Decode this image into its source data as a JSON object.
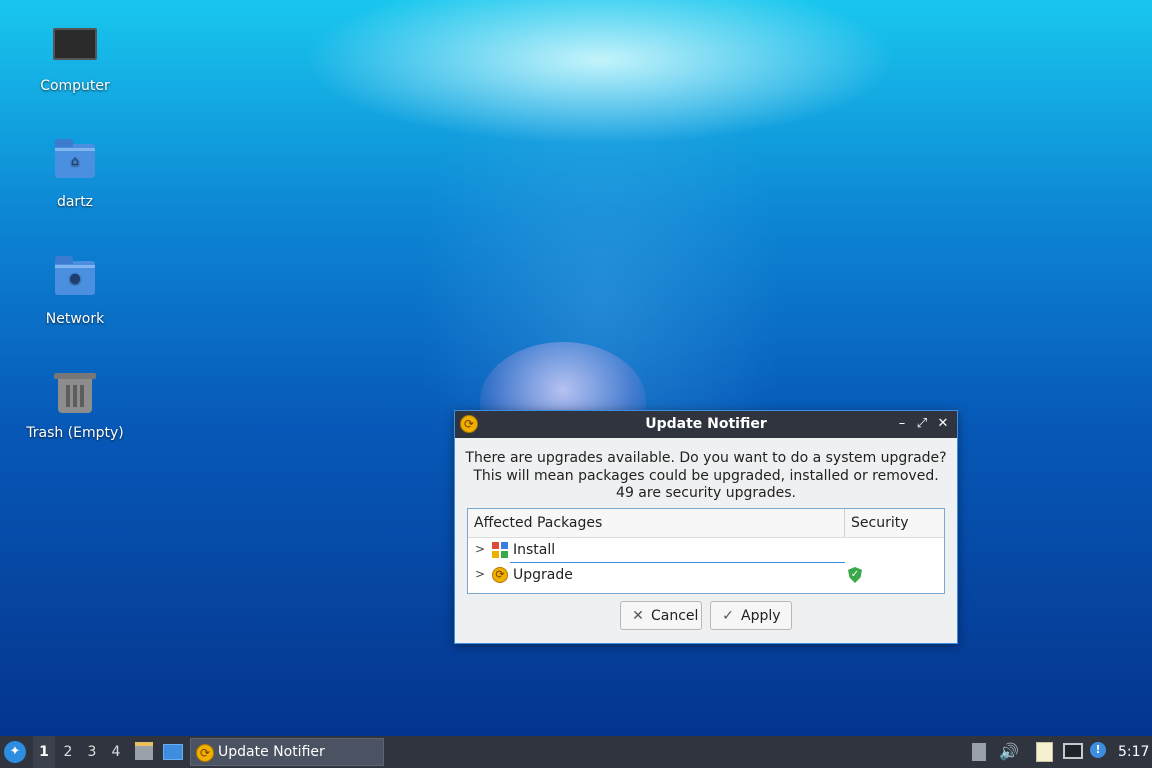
{
  "desktop": {
    "icons": [
      {
        "label": "Computer"
      },
      {
        "label": "dartz"
      },
      {
        "label": "Network"
      },
      {
        "label": "Trash (Empty)"
      }
    ]
  },
  "dialog": {
    "title": "Update Notifier",
    "message_line1": "There are upgrades available. Do you want to do a system upgrade?",
    "message_line2": "This will mean packages could be upgraded, installed or removed.",
    "message_line3": "49 are security upgrades.",
    "columns": [
      "Affected Packages",
      "Security"
    ],
    "rows": [
      {
        "label": "Install",
        "icon": "package-install-icon",
        "security": false
      },
      {
        "label": "Upgrade",
        "icon": "update-icon",
        "security": true
      }
    ],
    "buttons": {
      "cancel": "Cancel",
      "apply": "Apply"
    }
  },
  "taskbar": {
    "workspaces": [
      "1",
      "2",
      "3",
      "4"
    ],
    "active_workspace": "1",
    "task_label": "Update Notifier",
    "clock": "5:17"
  },
  "colors": {
    "accent": "#3d8ee0",
    "panel": "#2f343f",
    "security": "#3aa84a"
  }
}
